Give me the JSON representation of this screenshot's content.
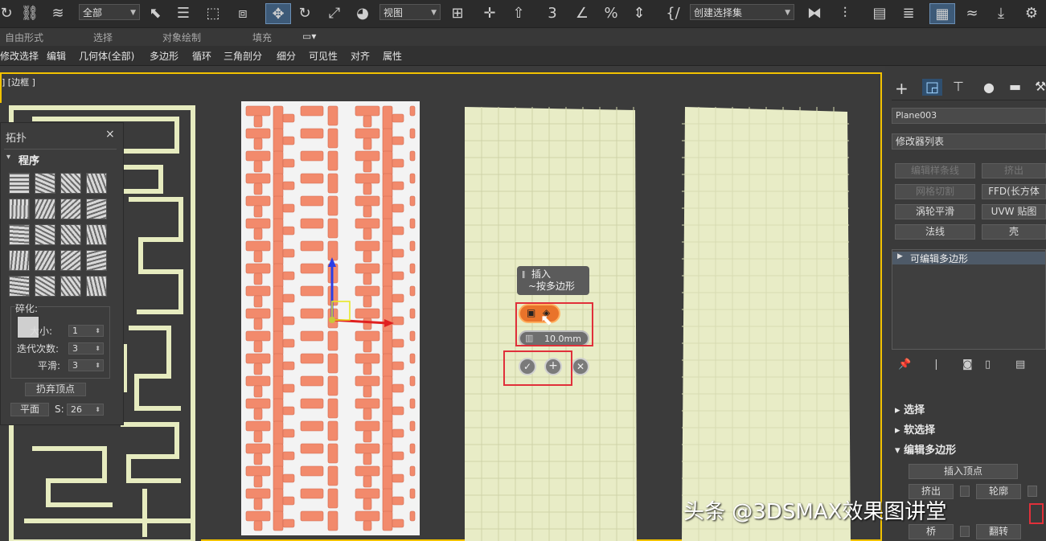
{
  "toolbar": {
    "selection_filter": "全部",
    "reference_coord": "视图",
    "named_selection": "创建选择集"
  },
  "ribbon": {
    "group_labels": [
      "自由形式",
      "选择",
      "对象绘制",
      "填充"
    ],
    "tabs": [
      "修改选择",
      "编辑",
      "几何体(全部)",
      "多边形",
      "循环",
      "三角剖分",
      "细分",
      "可见性",
      "对齐",
      "属性"
    ]
  },
  "viewport": {
    "label": "] [边框 ]"
  },
  "topology_panel": {
    "title": "拓扑",
    "close": "×",
    "section": "程序",
    "refine_label": "碎化:",
    "size_label": "大小:",
    "size_value": "1",
    "iterations_label": "迭代次数:",
    "iterations_value": "3",
    "smooth_label": "平滑:",
    "smooth_value": "3",
    "discard_vertices": "扔弃顶点",
    "flat_button": "平面",
    "s_label": "S:",
    "s_value": "26"
  },
  "caddy": {
    "title_line1": "插入",
    "title_line2": "~按多边形",
    "amount_value": "10.0mm",
    "ok_icon": "check-icon",
    "apply_icon": "plus-icon",
    "cancel_icon": "cancel-icon"
  },
  "command_panel": {
    "object_name": "Plane003",
    "modifier_list": "修改器列表",
    "buttons": [
      "编辑样条线",
      "挤出",
      "网格切割",
      "FFD(长方体",
      "涡轮平滑",
      "UVW 贴图",
      "法线",
      "壳"
    ],
    "stack_item": "可编辑多边形",
    "rollouts": [
      "选择",
      "软选择",
      "编辑多边形"
    ],
    "insert_vertex": "插入顶点",
    "extrude": "挤出",
    "outline": "轮廓",
    "bridge": "桥",
    "flip": "翻转"
  },
  "watermark": "头条 @3DSMAX效果图讲堂"
}
